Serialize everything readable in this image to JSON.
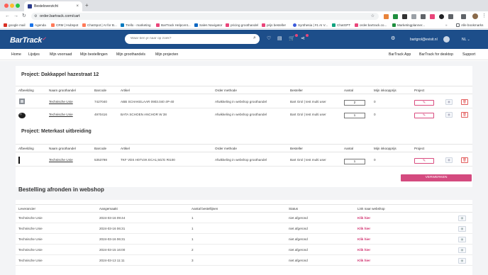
{
  "browser": {
    "tab_title": "Besteloverzicht",
    "tab_close": "×",
    "new_tab": "+",
    "url": "order.bartrack.com/cart",
    "bookmarks": [
      {
        "label": "google mail",
        "color": "#d93025"
      },
      {
        "label": "Agenda",
        "color": "#1a73e8"
      },
      {
        "label": "CRM | Hubspot",
        "color": "#ff7a59"
      },
      {
        "label": "ChatSpot | AI for B...",
        "color": "#ff7a59"
      },
      {
        "label": "Trello - marketing",
        "color": "#0079bf"
      },
      {
        "label": "BarTrack Helpcent...",
        "color": "#e9457a"
      },
      {
        "label": "Sales Navigator",
        "color": "#0a66c2"
      },
      {
        "label": "pricing groothandel",
        "color": "#e9457a"
      },
      {
        "label": "prijs besteller",
        "color": "#e9457a"
      },
      {
        "label": "Synthesia | #1 AI V...",
        "color": "#3b5bdb"
      },
      {
        "label": "ChatGPT",
        "color": "#10a37f"
      },
      {
        "label": "order.bartrack.co...",
        "color": "#e9457a"
      },
      {
        "label": "Marketingplanner...",
        "color": "#1e8e3e"
      },
      {
        "label": "Alle bookmarks",
        "color": "#5f6368"
      }
    ]
  },
  "header": {
    "logo": "BarTrack",
    "search_placeholder": "Waar ben je naar op zoek?",
    "cart_count": "",
    "user_email": "bartgrol@evisit.nl",
    "language": "NL"
  },
  "nav": {
    "left": [
      "Home",
      "Lijstjes",
      "Mijn voorraad",
      "Mijn bestellingen",
      "Mijn groothandels",
      "Mijn projecten"
    ],
    "right": [
      "BarTrack App",
      "BarTrack for desktop",
      "Support"
    ]
  },
  "columns": [
    "Afbeelding",
    "Naam groothandel",
    "Barcode",
    "Artikel",
    "Order methode",
    "Besteller",
    "Aantal",
    "Mijn inkoopprijs",
    "Project"
  ],
  "projects": [
    {
      "title": "Project: Dakkappel hazestraat 12",
      "rows": [
        {
          "wholesaler": "Technische Unie",
          "barcode": "7427040",
          "article": "ABB SCHAKELAAR 0903.040 4P-40",
          "method": "Afwikkeling in webshop groothandel",
          "orderer": "Bart Grol | test multi user",
          "qty": "2",
          "price": "0"
        },
        {
          "wholesaler": "Technische Unie",
          "barcode": "4970416",
          "article": "BATA SCHOEN ANCHOR W 38",
          "method": "Afwikkeling in webshop groothandel",
          "orderer": "Bart Grol | test multi user",
          "qty": "1",
          "price": "0"
        }
      ]
    },
    {
      "title": "Project: Meterkast uitbreiding",
      "rows": [
        {
          "wholesaler": "Technische Unie",
          "barcode": "5353798",
          "article": "TKF VDS H07V2K ECA1,5G/G RI100",
          "method": "Afwikkeling in webshop groothandel",
          "orderer": "Bart Grol | test multi user",
          "qty": "1",
          "price": "0"
        }
      ]
    }
  ],
  "process_button": "VERWERKEN",
  "finish": {
    "title": "Bestelling afronden in webshop",
    "columns": [
      "Leverancier",
      "Aangemaakt",
      "Aantal bestellijnen",
      "Status",
      "Link naar webshop"
    ],
    "rows": [
      {
        "supplier": "Technische Unie",
        "created": "2024-03-16 09:44",
        "lines": "1",
        "status": "niet afgerond",
        "link": "Klik hier"
      },
      {
        "supplier": "Technische Unie",
        "created": "2024-03-16 06:31",
        "lines": "1",
        "status": "niet afgerond",
        "link": "Klik hier"
      },
      {
        "supplier": "Technische Unie",
        "created": "2024-03-16 06:31",
        "lines": "1",
        "status": "niet afgerond",
        "link": "Klik hier"
      },
      {
        "supplier": "Technische Unie",
        "created": "2024-03-15 16:00",
        "lines": "2",
        "status": "niet afgerond",
        "link": "Klik hier"
      },
      {
        "supplier": "Technische Unie",
        "created": "2024-03-13 11:11",
        "lines": "3",
        "status": "niet afgerond",
        "link": "Klik hier"
      }
    ]
  },
  "icons": {
    "edit": "✎",
    "view": "◉",
    "delete": "🗑"
  }
}
